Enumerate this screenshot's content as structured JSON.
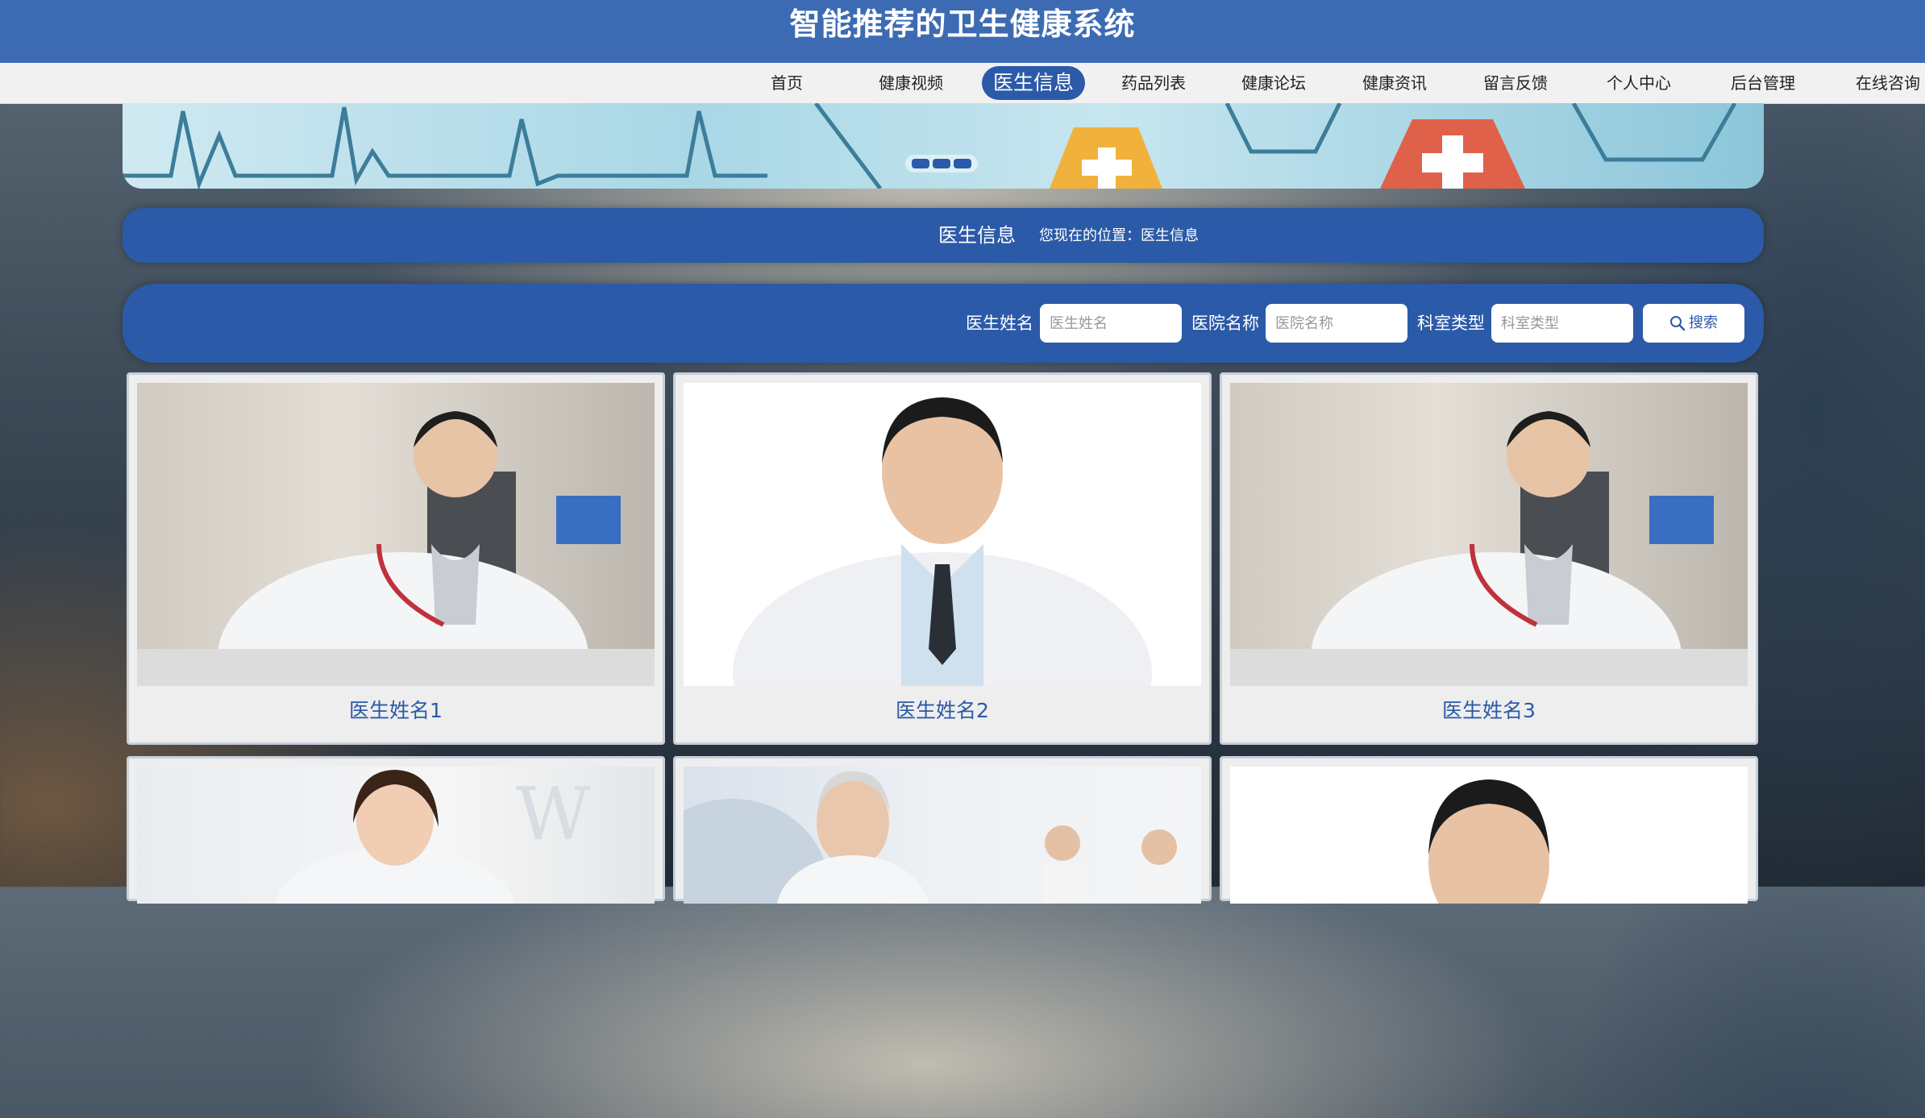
{
  "header": {
    "title": "智能推荐的卫生健康系统"
  },
  "nav": {
    "items": [
      {
        "label": "首页"
      },
      {
        "label": "健康视频"
      },
      {
        "label": "医生信息"
      },
      {
        "label": "药品列表"
      },
      {
        "label": "健康论坛"
      },
      {
        "label": "健康资讯"
      },
      {
        "label": "留言反馈"
      },
      {
        "label": "个人中心"
      },
      {
        "label": "后台管理"
      },
      {
        "label": "在线咨询"
      }
    ],
    "active_index": 2
  },
  "breadcrumb": {
    "title": "医生信息",
    "position_text": "您现在的位置：医生信息"
  },
  "search": {
    "fields": [
      {
        "label": "医生姓名",
        "placeholder": "医生姓名",
        "value": ""
      },
      {
        "label": "医院名称",
        "placeholder": "医院名称",
        "value": ""
      },
      {
        "label": "科室类型",
        "placeholder": "科室类型",
        "value": ""
      }
    ],
    "button_label": "搜索",
    "button_icon": "search-icon"
  },
  "doctors": [
    {
      "name": "医生姓名1"
    },
    {
      "name": "医生姓名2"
    },
    {
      "name": "医生姓名3"
    },
    {
      "name": ""
    },
    {
      "name": ""
    },
    {
      "name": ""
    }
  ],
  "colors": {
    "primary": "#2b5aa8",
    "header_bg": "#3d6bb3",
    "nav_bg": "#f1f1f1"
  }
}
